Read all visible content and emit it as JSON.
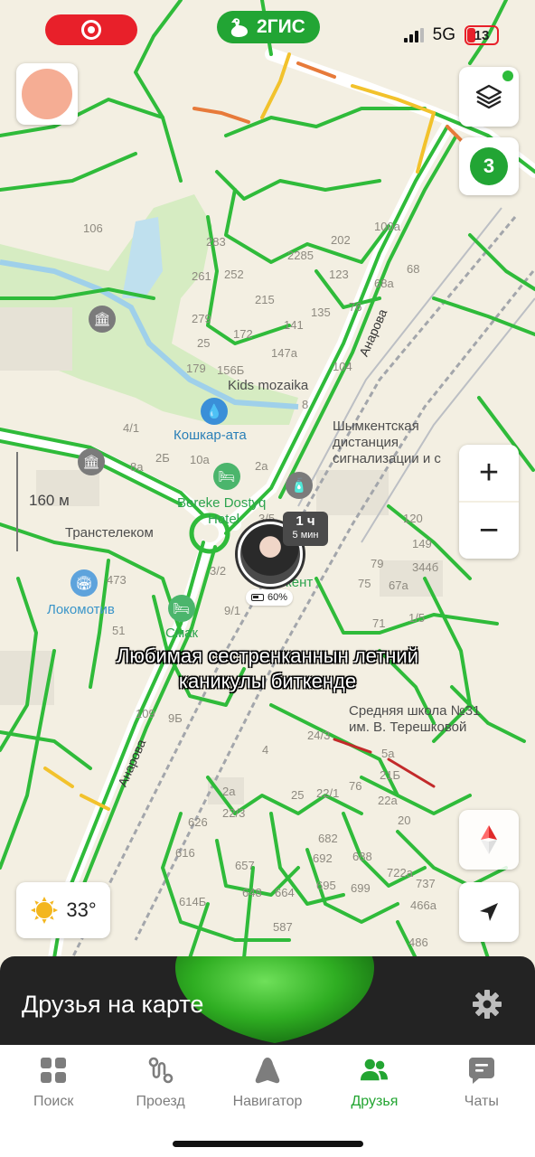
{
  "status_bar": {
    "brand": "2ГИС",
    "network": "5G",
    "battery_level": "13",
    "battery_color": "#e8202a"
  },
  "map": {
    "friends_count": "3",
    "scale_label": "160 м",
    "weather_temp": "33°",
    "places": {
      "kids_mozaika": "Kids mozaika",
      "koshkar_ata": "Кошкар-ата",
      "shymkent_line1": "Шымкентская",
      "shymkent_line2": "дистанция",
      "shymkent_line3": "сигнализации и с",
      "bereke": "Bereke Dostyq",
      "hotel": "Hotel",
      "transtelecom": "Транстелеком",
      "lokomotiv": "Локомотив",
      "smak": "Смак",
      "kent": "кент",
      "school_line1": "Средняя школа №31",
      "school_line2": "им. В. Терешковой"
    },
    "streets": {
      "anarova_top": "Анарова",
      "anarova_bottom": "Анарова"
    },
    "house_numbers": [
      "106",
      "283",
      "2285",
      "202",
      "100а",
      "261",
      "252",
      "215",
      "123",
      "68",
      "68а",
      "279",
      "172",
      "135",
      "76",
      "141",
      "25",
      "147а",
      "179",
      "156Б",
      "104",
      "8",
      "4/1",
      "2Б",
      "10а",
      "8а",
      "2а",
      "3/5",
      "120",
      "149",
      "344б",
      "79",
      "75",
      "67а",
      "71",
      "1/5",
      "473",
      "3/2",
      "9/1",
      "51",
      "109",
      "9Б",
      "24/3",
      "5а",
      "21Б",
      "22а",
      "4",
      "76",
      "25",
      "22/1",
      "2а",
      "22/3",
      "20",
      "626",
      "682",
      "616",
      "692",
      "688",
      "657",
      "695",
      "699",
      "722а",
      "737",
      "648",
      "664",
      "614Б",
      "587",
      "466а",
      "486"
    ]
  },
  "friend_marker": {
    "time_hours": "1 ч",
    "time_minutes": "5 мин",
    "battery": "60%"
  },
  "caption": {
    "line1": "Любимая сестренканнын летний",
    "line2": "каникулы биткенде"
  },
  "panel": {
    "title": "Друзья на карте",
    "accent_color": "#22a534"
  },
  "tabs": [
    {
      "label": "Поиск",
      "icon": "grid-icon",
      "active": false
    },
    {
      "label": "Проезд",
      "icon": "route-icon",
      "active": false
    },
    {
      "label": "Навигатор",
      "icon": "navigator-icon",
      "active": false
    },
    {
      "label": "Друзья",
      "icon": "friends-icon",
      "active": true
    },
    {
      "label": "Чаты",
      "icon": "chat-icon",
      "active": false
    }
  ]
}
